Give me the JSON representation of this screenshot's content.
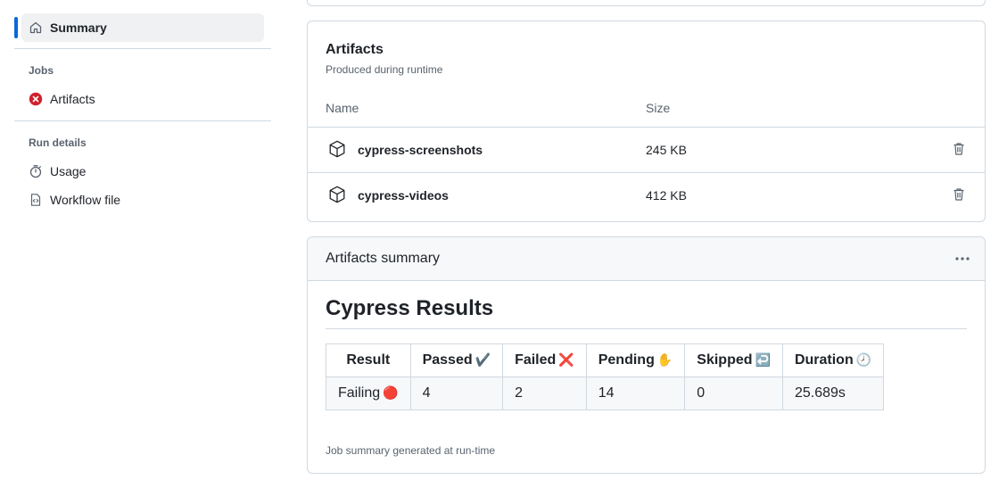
{
  "sidebar": {
    "summary_label": "Summary",
    "jobs_heading": "Jobs",
    "job_items": [
      {
        "label": "Artifacts",
        "status": "failed"
      }
    ],
    "run_details_heading": "Run details",
    "usage_label": "Usage",
    "workflow_label": "Workflow file"
  },
  "artifacts": {
    "title": "Artifacts",
    "subtitle": "Produced during runtime",
    "columns": {
      "name": "Name",
      "size": "Size"
    },
    "rows": [
      {
        "name": "cypress-screenshots",
        "size": "245 KB"
      },
      {
        "name": "cypress-videos",
        "size": "412 KB"
      }
    ]
  },
  "summary": {
    "header": "Artifacts summary",
    "heading": "Cypress Results",
    "table": {
      "headers": [
        {
          "label": "Result",
          "emoji": ""
        },
        {
          "label": "Passed",
          "emoji": "✔️"
        },
        {
          "label": "Failed",
          "emoji": "❌"
        },
        {
          "label": "Pending",
          "emoji": "✋"
        },
        {
          "label": "Skipped",
          "emoji": "↩️"
        },
        {
          "label": "Duration",
          "emoji": "🕗"
        }
      ],
      "row": [
        {
          "value": "Failing",
          "emoji": "🔴"
        },
        {
          "value": "4",
          "emoji": ""
        },
        {
          "value": "2",
          "emoji": ""
        },
        {
          "value": "14",
          "emoji": ""
        },
        {
          "value": "0",
          "emoji": ""
        },
        {
          "value": "25.689s",
          "emoji": ""
        }
      ]
    },
    "footer": "Job summary generated at run-time"
  },
  "colors": {
    "accent": "#0969da",
    "danger": "#cf222e",
    "muted": "#59636e",
    "border": "#d1d9e0"
  }
}
